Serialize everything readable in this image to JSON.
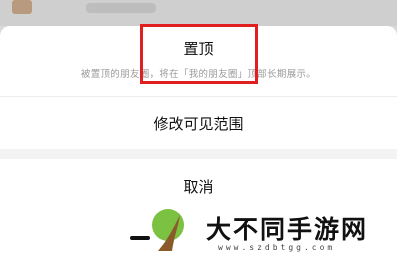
{
  "background": {
    "overlay_color": "#cfcfcf",
    "avatar_color": "#b08a64"
  },
  "action_sheet": {
    "pin": {
      "label": "置顶",
      "description": "被置顶的朋友圈，将在「我的朋友圈」顶部长期展示。"
    },
    "visibility": {
      "label": "修改可见范围"
    },
    "cancel": {
      "label": "取消"
    }
  },
  "annotation": {
    "highlight_color": "#e02020"
  },
  "watermark": {
    "title": "大不同手游网",
    "url": "www.szdbtgg.com",
    "leaf_color": "#7cc242",
    "trunk_color": "#8b5a2b"
  }
}
